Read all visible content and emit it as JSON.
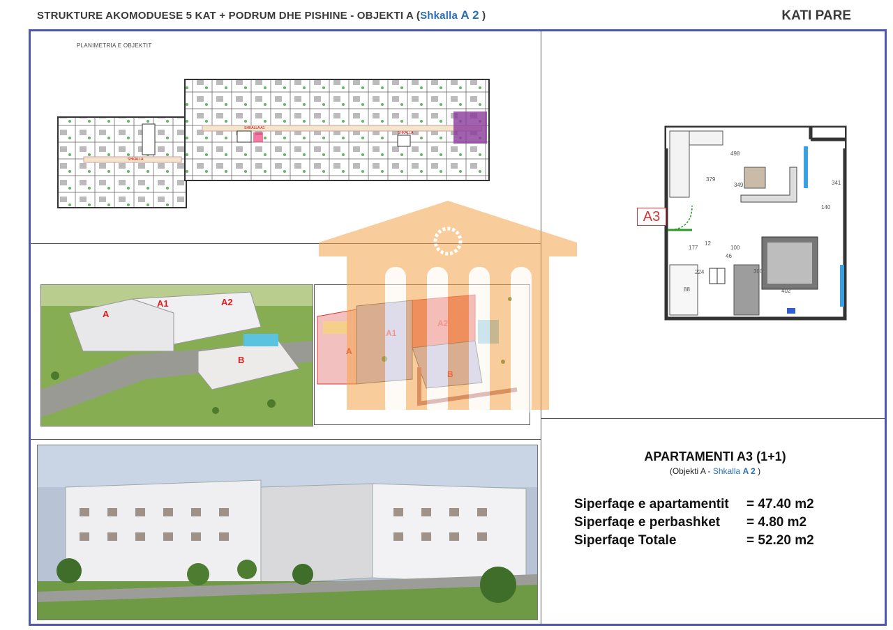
{
  "header": {
    "title_main": "STRUKTURE AKOMODUESE 5 KAT + PODRUM DHE PISHINE",
    "title_obj": " -  OBJEKTI A (",
    "title_shkalla": "Shkalla",
    "title_code": "A 2",
    "title_close": " )",
    "floor": "KATI PARE"
  },
  "site_plan": {
    "label": "PLANIMETRIA E OBJEKTIT",
    "stair_labels": [
      "SHKALLA",
      "SHKALLA A1",
      "SHKALLA"
    ]
  },
  "aerial_view": {
    "labels": [
      "A",
      "A1",
      "A2",
      "B"
    ]
  },
  "site_diagram": {
    "labels": [
      "A",
      "A1",
      "A2",
      "B"
    ]
  },
  "apartment_plan": {
    "tag": "A3",
    "dimensions": [
      "498",
      "379",
      "349",
      "341",
      "140",
      "177",
      "12",
      "100",
      "46",
      "300",
      "402",
      "224",
      "88"
    ]
  },
  "apartment": {
    "title": "APARTAMENTI A3 (1+1)",
    "sub_prefix": "(Objekti A - ",
    "sub_shkalla": "Shkalla",
    "sub_code": "A 2",
    "sub_suffix": " )",
    "areas": [
      {
        "label": "Siperfaqe e apartamentit",
        "value": "= 47.40 m2"
      },
      {
        "label": "Siperfaqe e perbashket",
        "value": "=  4.80 m2"
      },
      {
        "label": "Siperfaqe Totale",
        "value": "= 52.20 m2"
      }
    ]
  },
  "colors": {
    "frame": "#4a58b3",
    "accent": "#2a6fb5",
    "label_red": "#e02020",
    "watermark": "#f5a34a"
  }
}
